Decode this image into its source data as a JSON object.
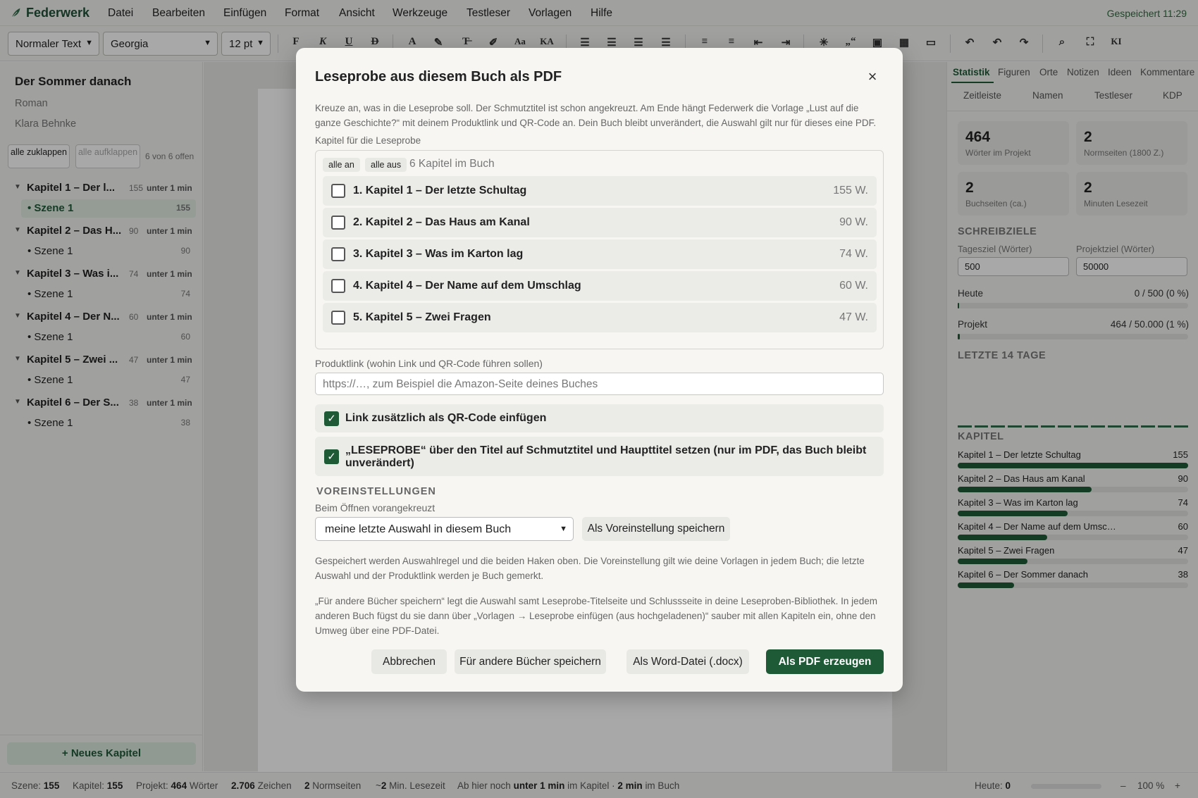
{
  "app": {
    "name": "Federwerk",
    "saved_status": "Gespeichert 11:29"
  },
  "menu": [
    "Datei",
    "Bearbeiten",
    "Einfügen",
    "Format",
    "Ansicht",
    "Werkzeuge",
    "Testleser",
    "Vorlagen",
    "Hilfe"
  ],
  "toolbar": {
    "style": "Normaler Text",
    "font": "Georgia",
    "size": "12 pt",
    "bold": "F",
    "italic": "K",
    "underline": "U",
    "strike": "D",
    "textcolor": "A",
    "case1": "Aa",
    "case2": "KA",
    "quote": "„“",
    "ai": "KI"
  },
  "sidebar": {
    "book_title": "Der Sommer danach",
    "genre": "Roman",
    "author": "Klara Behnke",
    "collapse_all": "alle zuklappen",
    "expand_all": "alle aufklappen",
    "open_count": "6 von 6 offen",
    "chapters": [
      {
        "name": "Kapitel 1 – Der l...",
        "words": "155",
        "time": "unter 1 min",
        "scene": "Szene 1",
        "scene_words": "155"
      },
      {
        "name": "Kapitel 2 – Das H...",
        "words": "90",
        "time": "unter 1 min",
        "scene": "Szene 1",
        "scene_words": "90"
      },
      {
        "name": "Kapitel 3 – Was i...",
        "words": "74",
        "time": "unter 1 min",
        "scene": "Szene 1",
        "scene_words": "74"
      },
      {
        "name": "Kapitel 4 – Der N...",
        "words": "60",
        "time": "unter 1 min",
        "scene": "Szene 1",
        "scene_words": "60"
      },
      {
        "name": "Kapitel 5 – Zwei ...",
        "words": "47",
        "time": "unter 1 min",
        "scene": "Szene 1",
        "scene_words": "47"
      },
      {
        "name": "Kapitel 6 – Der S...",
        "words": "38",
        "time": "unter 1 min",
        "scene": "Szene 1",
        "scene_words": "38"
      }
    ],
    "new_chapter": "+ Neues Kapitel"
  },
  "right": {
    "tabs": [
      "Statistik",
      "Figuren",
      "Orte",
      "Notizen",
      "Ideen",
      "Kommentare"
    ],
    "tabs2": [
      "Zeitleiste",
      "Namen",
      "Testleser",
      "KDP"
    ],
    "stats": [
      {
        "value": "464",
        "label": "Wörter im Projekt"
      },
      {
        "value": "2",
        "label": "Normseiten (1800 Z.)"
      },
      {
        "value": "2",
        "label": "Buchseiten (ca.)"
      },
      {
        "value": "2",
        "label": "Minuten Lesezeit"
      }
    ],
    "goals_head": "SCHREIBZIELE",
    "daily_label": "Tagesziel (Wörter)",
    "project_label": "Projektziel (Wörter)",
    "daily_value": "500",
    "project_value": "50000",
    "today_label": "Heute",
    "today_value": "0 / 500 (0 %)",
    "today_pct": 0,
    "project_prog_label": "Projekt",
    "project_prog_value": "464 / 50.000 (1 %)",
    "project_pct": 1,
    "last14_head": "LETZTE 14 TAGE",
    "chapters_head": "KAPITEL",
    "chapter_stats": [
      {
        "name": "Kapitel 1 – Der letzte Schultag",
        "words": "155",
        "n": 155
      },
      {
        "name": "Kapitel 2 – Das Haus am Kanal",
        "words": "90",
        "n": 90
      },
      {
        "name": "Kapitel 3 – Was im Karton lag",
        "words": "74",
        "n": 74
      },
      {
        "name": "Kapitel 4 – Der Name auf dem Umsc…",
        "words": "60",
        "n": 60
      },
      {
        "name": "Kapitel 5 – Zwei Fragen",
        "words": "47",
        "n": 47
      },
      {
        "name": "Kapitel 6 – Der Sommer danach",
        "words": "38",
        "n": 38
      }
    ]
  },
  "status": {
    "scene_label": "Szene:",
    "scene_value": "155",
    "chapter_label": "Kapitel:",
    "chapter_value": "155",
    "project_label": "Projekt:",
    "project_value": "464",
    "words_label": "Wörter",
    "chars_value": "2.706",
    "chars_label": "Zeichen",
    "normpages_value": "2",
    "normpages_label": "Normseiten",
    "read_prefix": "~",
    "read_value": "2",
    "read_label": "Min. Lesezeit",
    "remaining_prefix": "Ab hier noch",
    "remaining_chapter": "unter 1 min",
    "remaining_mid": "im Kapitel ·",
    "remaining_book": "2 min",
    "remaining_suffix": "im Buch",
    "today_label": "Heute:",
    "today_value": "0",
    "zoom_minus": "–",
    "zoom_value": "100 %",
    "zoom_plus": "+"
  },
  "dialog": {
    "title": "Leseprobe aus diesem Buch als PDF",
    "close": "×",
    "intro": "Kreuze an, was in die Leseprobe soll. Der Schmutztitel ist schon angekreuzt. Am Ende hängt Federwerk die Vorlage „Lust auf die ganze Geschichte?“ mit deinem Produktlink und QR-Code an. Dein Buch bleibt unverändert, die Auswahl gilt nur für dieses eine PDF.",
    "chapters_label": "Kapitel für die Leseprobe",
    "all_on": "alle an",
    "all_off": "alle aus",
    "chapter_count": "6 Kapitel im Buch",
    "chapters": [
      {
        "title": "1. Kapitel 1 – Der letzte Schultag",
        "words": "155 W."
      },
      {
        "title": "2. Kapitel 2 – Das Haus am Kanal",
        "words": "90 W."
      },
      {
        "title": "3. Kapitel 3 – Was im Karton lag",
        "words": "74 W."
      },
      {
        "title": "4. Kapitel 4 – Der Name auf dem Umschlag",
        "words": "60 W."
      },
      {
        "title": "5. Kapitel 5 – Zwei Fragen",
        "words": "47 W."
      }
    ],
    "link_label": "Produktlink (wohin Link und QR-Code führen sollen)",
    "link_placeholder": "https://…, zum Beispiel die Amazon-Seite deines Buches",
    "qr_option": "Link zusätzlich als QR-Code einfügen",
    "stamp_option": "„LESEPROBE“ über den Titel auf Schmutztitel und Haupttitel setzen (nur im PDF, das Buch bleibt unverändert)",
    "presets_head": "VOREINSTELLUNGEN",
    "presets_label": "Beim Öffnen vorangekreuzt",
    "presets_select": "meine letzte Auswahl in diesem Buch",
    "presets_save": "Als Voreinstellung speichern",
    "note1": "Gespeichert werden Auswahlregel und die beiden Haken oben. Die Voreinstellung gilt wie deine Vorlagen in jedem Buch; die letzte Auswahl und der Produktlink werden je Buch gemerkt.",
    "note2": "„Für andere Bücher speichern“ legt die Auswahl samt Leseprobe-Titelseite und Schlussseite in deine Leseproben-Bibliothek. In jedem anderen Buch fügst du sie dann über „Vorlagen → Leseprobe einfügen (aus hochgeladenen)“ sauber mit allen Kapiteln ein, ohne den Umweg über eine PDF-Datei.",
    "cancel": "Abbrechen",
    "save_other": "Für andere Bücher speichern",
    "word": "Als Word-Datei (.docx)",
    "pdf": "Als PDF erzeugen"
  }
}
